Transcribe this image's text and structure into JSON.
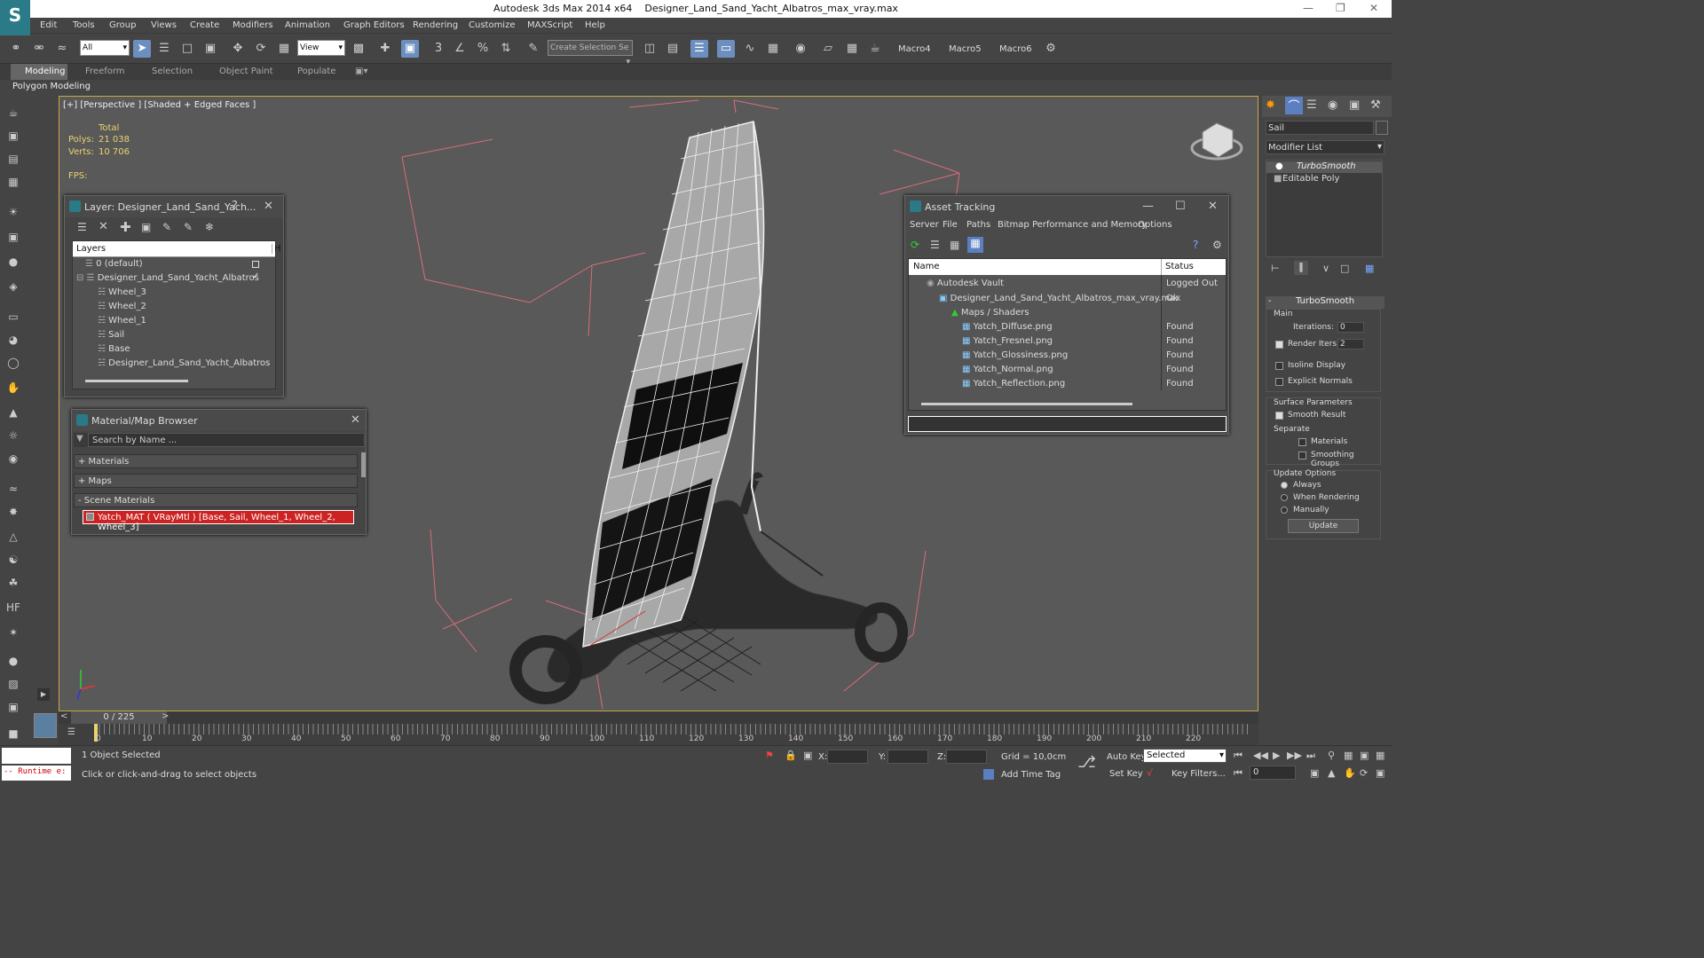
{
  "titlebar": {
    "app": "Autodesk 3ds Max  2014 x64",
    "file": "Designer_Land_Sand_Yacht_Albatros_max_vray.max"
  },
  "menu": [
    "Edit",
    "Tools",
    "Group",
    "Views",
    "Create",
    "Modifiers",
    "Animation",
    "Graph Editors",
    "Rendering",
    "Customize",
    "MAXScript",
    "Help"
  ],
  "toolbar": {
    "filter_value": "All",
    "refcoord_value": "View",
    "selection_set_placeholder": "Create Selection Se",
    "macros": [
      "Macro4",
      "Macro5",
      "Macro6"
    ]
  },
  "ribbon": {
    "tabs": [
      "Modeling",
      "Freeform",
      "Selection",
      "Object Paint",
      "Populate"
    ],
    "active": "Modeling",
    "sub_label": "Polygon Modeling"
  },
  "viewport": {
    "label": "[+] [Perspective ] [Shaded + Edged Faces ]",
    "stats_header": "Total",
    "polys_label": "Polys:",
    "polys_value": "21 038",
    "verts_label": "Verts:",
    "verts_value": "10 706",
    "fps_label": "FPS:"
  },
  "layer_window": {
    "title": "Layer: Designer_Land_Sand_Yach...",
    "help": "?",
    "column": "Layers",
    "column_h": "H",
    "rows": [
      {
        "name": "0 (default)",
        "level": 0
      },
      {
        "name": "Designer_Land_Sand_Yacht_Albatros",
        "level": 0
      },
      {
        "name": "Wheel_3",
        "level": 1
      },
      {
        "name": "Wheel_2",
        "level": 1
      },
      {
        "name": "Wheel_1",
        "level": 1
      },
      {
        "name": "Sail",
        "level": 1
      },
      {
        "name": "Base",
        "level": 1
      },
      {
        "name": "Designer_Land_Sand_Yacht_Albatros",
        "level": 1
      }
    ]
  },
  "material_browser": {
    "title": "Material/Map Browser",
    "search_placeholder": "Search by Name ...",
    "sections": [
      "+ Materials",
      "+ Maps",
      "- Scene Materials"
    ],
    "scene_material": "Yatch_MAT  ( VRayMtl )  [Base, Sail, Wheel_1, Wheel_2, Wheel_3]"
  },
  "asset_tracking": {
    "title": "Asset Tracking",
    "menu": [
      "Server",
      "File",
      "Paths",
      "Bitmap Performance and Memory",
      "Options"
    ],
    "col_name": "Name",
    "col_status": "Status",
    "rows": [
      {
        "name": "Autodesk Vault",
        "status": "Logged Out ...",
        "indent": 1
      },
      {
        "name": "Designer_Land_Sand_Yacht_Albatros_max_vray.max",
        "status": "Ok",
        "indent": 2
      },
      {
        "name": "Maps / Shaders",
        "status": "",
        "indent": 3
      },
      {
        "name": "Yatch_Diffuse.png",
        "status": "Found",
        "indent": 4
      },
      {
        "name": "Yatch_Fresnel.png",
        "status": "Found",
        "indent": 4
      },
      {
        "name": "Yatch_Glossiness.png",
        "status": "Found",
        "indent": 4
      },
      {
        "name": "Yatch_Normal.png",
        "status": "Found",
        "indent": 4
      },
      {
        "name": "Yatch_Reflection.png",
        "status": "Found",
        "indent": 4
      }
    ]
  },
  "command_panel": {
    "object_name": "Sail",
    "modifier_list": "Modifier List",
    "stack": [
      "TurboSmooth",
      "Editable Poly"
    ],
    "rollout_title": "TurboSmooth",
    "main": "Main",
    "iterations_label": "Iterations:",
    "iterations_value": "0",
    "render_iters_label": "Render Iters:",
    "render_iters_value": "2",
    "isoline": "Isoline Display",
    "explicit": "Explicit Normals",
    "surface_params": "Surface Parameters",
    "smooth_result": "Smooth Result",
    "separate": "Separate",
    "materials": "Materials",
    "smoothing_groups": "Smoothing Groups",
    "update_options": "Update Options",
    "always": "Always",
    "when_rendering": "When Rendering",
    "manually": "Manually",
    "update_button": "Update"
  },
  "timeline": {
    "frame": "0 / 225",
    "ticks": [
      "0",
      "10",
      "20",
      "30",
      "40",
      "50",
      "60",
      "70",
      "80",
      "90",
      "100",
      "110",
      "120",
      "130",
      "140",
      "150",
      "160",
      "170",
      "180",
      "190",
      "200",
      "210",
      "220"
    ]
  },
  "status": {
    "runtime": "-- Runtime e:",
    "selected": "1 Object Selected",
    "hint": "Click or click-and-drag to select objects",
    "x_label": "X:",
    "y_label": "Y:",
    "z_label": "Z:",
    "grid": "Grid = 10,0cm",
    "auto_key": "Auto Key",
    "set_key": "Set Key",
    "selected_value": "Selected",
    "key_filters": "Key Filters...",
    "add_time_tag": "Add Time Tag",
    "frame_value": "0"
  }
}
